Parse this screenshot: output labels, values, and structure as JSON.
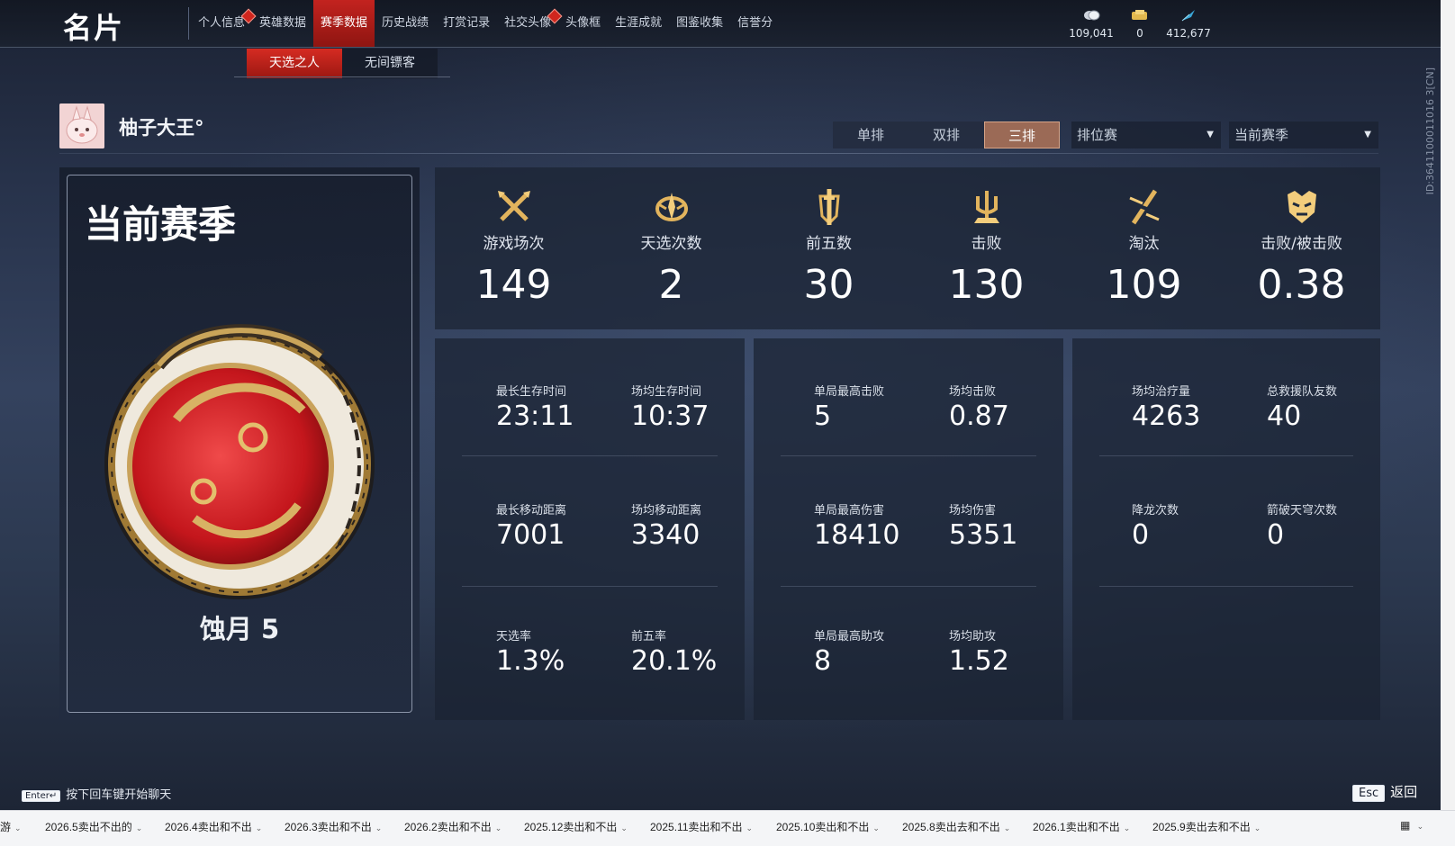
{
  "header": {
    "logo": "名片",
    "nav": [
      {
        "label": "个人信息",
        "badge": true
      },
      {
        "label": "英雄数据"
      },
      {
        "label": "赛季数据",
        "active": true
      },
      {
        "label": "历史战绩"
      },
      {
        "label": "打赏记录"
      },
      {
        "label": "社交头像",
        "badge": true
      },
      {
        "label": "头像框"
      },
      {
        "label": "生涯成就"
      },
      {
        "label": "图鉴收集"
      },
      {
        "label": "信誉分"
      }
    ],
    "currencies": [
      {
        "icon": "coin-stack-icon",
        "value": "109,041"
      },
      {
        "icon": "ticket-icon",
        "value": "0"
      },
      {
        "icon": "feather-icon",
        "value": "412,677"
      }
    ]
  },
  "subtabs": [
    {
      "label": "天选之人",
      "active": true
    },
    {
      "label": "无间镖客"
    }
  ],
  "player": {
    "name": "柚子大王°"
  },
  "modes": [
    {
      "label": "单排"
    },
    {
      "label": "双排"
    },
    {
      "label": "三排",
      "active": true
    }
  ],
  "dropdowns": {
    "match_type": "排位赛",
    "season": "当前赛季"
  },
  "left_panel": {
    "title": "当前赛季",
    "rank": "蚀月 5"
  },
  "stats": [
    {
      "icon": "crossed-swords-icon",
      "label": "游戏场次",
      "value": "149"
    },
    {
      "icon": "lotus-crest-icon",
      "label": "天选次数",
      "value": "2"
    },
    {
      "icon": "sword-shield-icon",
      "label": "前五数",
      "value": "30"
    },
    {
      "icon": "trident-icon",
      "label": "击败",
      "value": "130"
    },
    {
      "icon": "broken-blade-icon",
      "label": "淘汰",
      "value": "109"
    },
    {
      "icon": "demon-mask-icon",
      "label": "击败/被击败",
      "value": "0.38"
    }
  ],
  "cards": [
    [
      {
        "label": "最长生存时间",
        "value": "23:11"
      },
      {
        "label": "场均生存时间",
        "value": "10:37"
      },
      {
        "label": "最长移动距离",
        "value": "7001"
      },
      {
        "label": "场均移动距离",
        "value": "3340"
      },
      {
        "label": "天选率",
        "value": "1.3%"
      },
      {
        "label": "前五率",
        "value": "20.1%"
      }
    ],
    [
      {
        "label": "单局最高击败",
        "value": "5"
      },
      {
        "label": "场均击败",
        "value": "0.87"
      },
      {
        "label": "单局最高伤害",
        "value": "18410"
      },
      {
        "label": "场均伤害",
        "value": "5351"
      },
      {
        "label": "单局最高助攻",
        "value": "8"
      },
      {
        "label": "场均助攻",
        "value": "1.52"
      }
    ],
    [
      {
        "label": "场均治疗量",
        "value": "4263"
      },
      {
        "label": "总救援队友数",
        "value": "40"
      },
      {
        "label": "降龙次数",
        "value": "0"
      },
      {
        "label": "箭破天穹次数",
        "value": "0"
      }
    ]
  ],
  "footer": {
    "enter_key": "Enter↵",
    "enter_hint": "按下回车键开始聊天",
    "esc_key": "Esc",
    "esc_label": "返回"
  },
  "side_id": "ID:3641100011016 3[CN]",
  "taskbar": {
    "items": [
      "游",
      "2026.5卖出不出的",
      "2026.4卖出和不出",
      "2026.3卖出和不出",
      "2026.2卖出和不出",
      "2025.12卖出和不出",
      "2025.11卖出和不出",
      "2025.10卖出和不出",
      "2025.8卖出去和不出",
      "2026.1卖出和不出",
      "2025.9卖出去和不出"
    ]
  },
  "colors": {
    "accent_red": "#c3231f",
    "active_mode": "#9b6a56",
    "gold": "#c9a25a"
  }
}
